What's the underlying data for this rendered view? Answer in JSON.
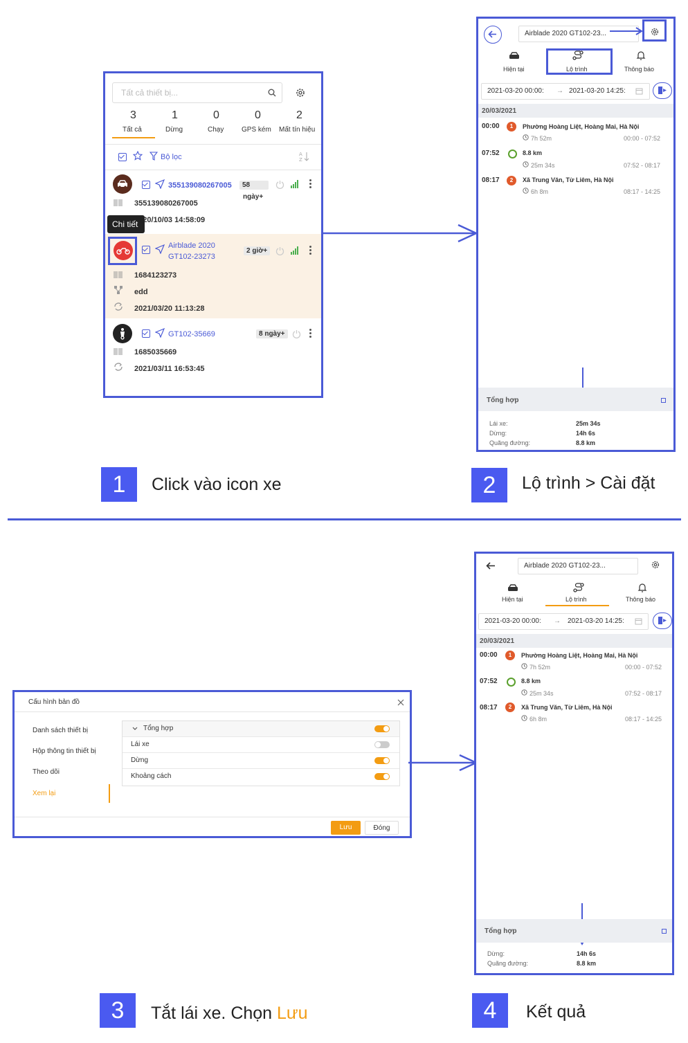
{
  "step1": {
    "search_placeholder": "Tất cả thiết bị...",
    "stats": [
      {
        "count": "3",
        "label": "Tất cả"
      },
      {
        "count": "1",
        "label": "Dừng"
      },
      {
        "count": "0",
        "label": "Chạy"
      },
      {
        "count": "0",
        "label": "GPS kém"
      },
      {
        "count": "2",
        "label": "Mất tín hiệu"
      }
    ],
    "filter_label": "Bộ lọc",
    "tooltip": "Chi tiết",
    "devices": [
      {
        "name": "355139080267005",
        "badge": "58",
        "badge2": "ngày+",
        "imei": "355139080267005",
        "time": "2020/10/03 14:58:09"
      },
      {
        "name": "Airblade 2020",
        "name2": "GT102-23273",
        "badge": "2 giờ+",
        "imei": "1684123273",
        "group": "edd",
        "time": "2021/03/20 11:13:28"
      },
      {
        "name": "GT102-35669",
        "badge": "8 ngày+",
        "imei": "1685035669",
        "time": "2021/03/11 16:53:45"
      }
    ]
  },
  "route": {
    "device_select": "Airblade 2020 GT102-23...",
    "tabs": [
      "Hiện tại",
      "Lộ trình",
      "Thông báo"
    ],
    "date_from": "2021-03-20 00:00:",
    "date_sep": "→",
    "date_to": "2021-03-20 14:25:",
    "day": "20/03/2021",
    "entries": [
      {
        "time": "00:00",
        "marker": "1",
        "title": "Phường Hoàng Liệt, Hoàng Mai, Hà Nội",
        "duration": "7h 52m",
        "range": "00:00 - 07:52"
      },
      {
        "time": "07:52",
        "marker": "",
        "title": "8.8 km",
        "duration": "25m 34s",
        "range": "07:52 - 08:17"
      },
      {
        "time": "08:17",
        "marker": "2",
        "title": "Xã Trung Văn, Từ Liêm, Hà Nội",
        "duration": "6h 8m",
        "range": "08:17 - 14:25"
      }
    ],
    "summary_title": "Tổng hợp",
    "summary_before": [
      {
        "label": "Lái xe:",
        "value": "25m 34s"
      },
      {
        "label": "Dừng:",
        "value": "14h 6s"
      },
      {
        "label": "Quãng đường:",
        "value": "8.8 km"
      }
    ],
    "summary_after": [
      {
        "label": "Dừng:",
        "value": "14h 6s"
      },
      {
        "label": "Quãng đường:",
        "value": "8.8 km"
      }
    ]
  },
  "config": {
    "title": "Cấu hình bản đồ",
    "menu": [
      "Danh sách thiết bị",
      "Hộp thông tin thiết bị",
      "Theo dõi",
      "Xem lại"
    ],
    "rows": [
      {
        "label": "Tổng hợp",
        "on": true
      },
      {
        "label": "Lái xe",
        "on": false
      },
      {
        "label": "Dừng",
        "on": true
      },
      {
        "label": "Khoảng cách",
        "on": true
      }
    ],
    "save": "Lưu",
    "close": "Đóng"
  },
  "steps": [
    {
      "num": "1",
      "text": "Click vào icon xe"
    },
    {
      "num": "2",
      "text": "Lộ trình > Cài đặt"
    },
    {
      "num": "3",
      "text": "Tắt lái xe. Chọn ",
      "highlight": "Lưu"
    },
    {
      "num": "4",
      "text": "Kết quả"
    }
  ],
  "colors": {
    "accent": "#4a5ad6",
    "orange": "#f39c12",
    "pin": "#e05a2b",
    "highlight_row": "#fbf1e4"
  }
}
